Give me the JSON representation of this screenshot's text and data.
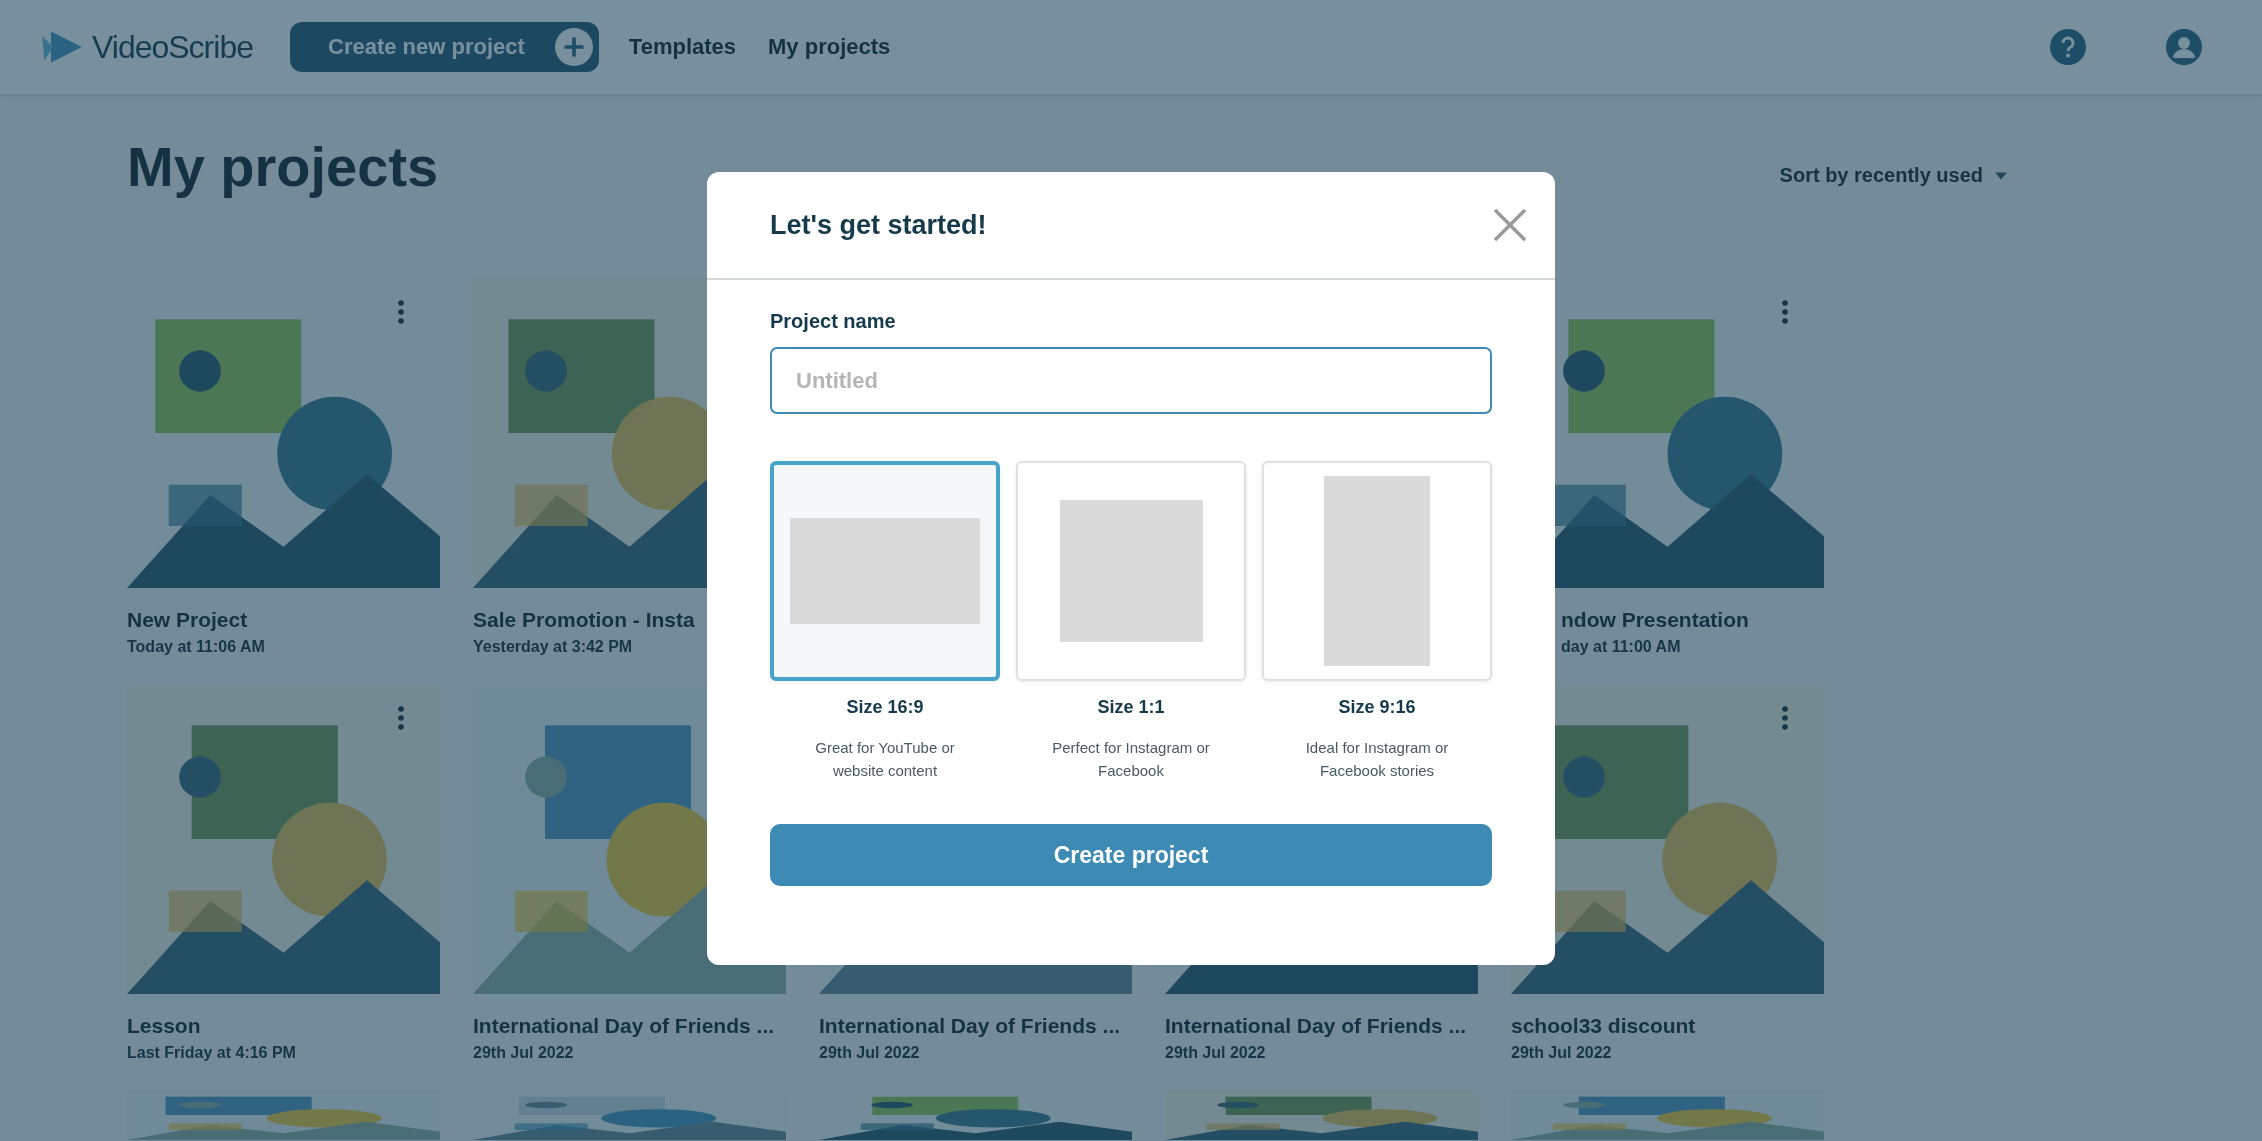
{
  "header": {
    "logo": "VideoScribe",
    "create_button": "Create new project",
    "nav": [
      {
        "label": "Templates"
      },
      {
        "label": "My projects"
      }
    ]
  },
  "page": {
    "title": "My projects",
    "sort": "Sort by recently used"
  },
  "project_rows": [
    [
      {
        "kind": "picture",
        "title": "New Project",
        "date": "Today at 11:06 AM",
        "has_menu": true
      },
      {
        "kind": "picture",
        "title": "Sale Promotion - Insta",
        "date": "Yesterday at 3:42 PM"
      },
      {
        "kind": "covered"
      },
      {
        "kind": "covered"
      },
      {
        "kind": "picture",
        "title": "ndow Presentation",
        "date": "day at 11:00 AM",
        "has_menu": true,
        "cut_left": true
      }
    ],
    [
      {
        "kind": "picture",
        "title": "Lesson",
        "date": "Last Friday at 4:16 PM",
        "has_menu": true
      },
      {
        "kind": "picture",
        "title": "International Day of Friends ...",
        "date": "29th Jul 2022"
      },
      {
        "kind": "picture",
        "title": "International Day of Friends ...",
        "date": "29th Jul 2022"
      },
      {
        "kind": "picture",
        "title": "International Day of Friends ...",
        "date": "29th Jul 2022"
      },
      {
        "kind": "picture",
        "title": "school33 discount",
        "date": "29th Jul 2022",
        "has_menu": true
      }
    ],
    [
      {
        "kind": "picture"
      },
      {
        "kind": "picture"
      },
      {
        "kind": "picture"
      },
      {
        "kind": "picture"
      },
      {
        "kind": "picture"
      }
    ]
  ],
  "dialog": {
    "title": "Let's get started!",
    "name_label": "Project name",
    "name_placeholder": "Untitled",
    "sizes": [
      {
        "kind": "wide",
        "label": "Size 16:9",
        "description": "Great for YouTube or website content",
        "selected": true
      },
      {
        "kind": "square",
        "label": "Size 1:1",
        "description": "Perfect for Instagram or Facebook",
        "selected": false
      },
      {
        "kind": "tall",
        "label": "Size 9:16",
        "description": "Ideal for Instagram or Facebook stories",
        "selected": false
      }
    ],
    "create_button": "Create project"
  }
}
